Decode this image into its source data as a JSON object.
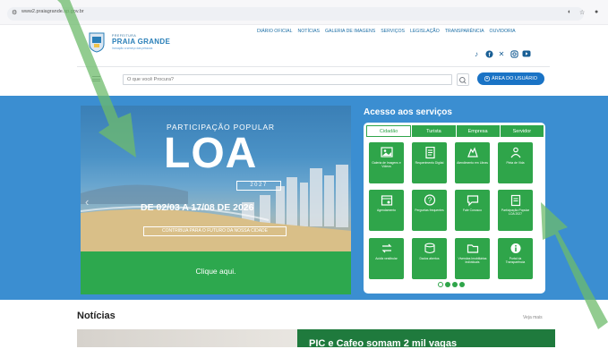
{
  "browser": {
    "url": "www2.praiagrande.sp.gov.br",
    "icons": [
      "site-info-icon",
      "hide-icon",
      "star-icon",
      "profile-icon"
    ]
  },
  "logo": {
    "small": "PREFEITURA",
    "title": "PRAIA GRANDE",
    "sub": "Inovação a serviço das pessoas"
  },
  "nav": [
    "DIÁRIO OFICIAL",
    "NOTÍCIAS",
    "GALERIA DE IMAGENS",
    "SERVIÇOS",
    "LEGISLAÇÃO",
    "TRANSPARÊNCIA",
    "OUVIDORIA"
  ],
  "socials": [
    "tiktok-icon",
    "facebook-icon",
    "x-icon",
    "instagram-icon",
    "youtube-icon"
  ],
  "search": {
    "placeholder": "O que você Procura?",
    "user_area": "ÁREA DO USUÁRIO"
  },
  "banner": {
    "header": "PARTICIPAÇÃO POPULAR",
    "title": "LOA",
    "year": "2027",
    "dates": "DE 02/03 A 17/08 DE 2026",
    "tagline": "CONTRIBUA PARA O FUTURO DA NOSSA CIDADE",
    "cta": "Clique aqui."
  },
  "services": {
    "title": "Acesso aos serviços",
    "tabs": [
      "Cidadão",
      "Turista",
      "Empresa",
      "Servidor"
    ],
    "active_tab": "Cidadão",
    "tiles": [
      {
        "label": "Galeria de Imagens e Vídeos",
        "icon": "image-icon"
      },
      {
        "label": "Requerimento Digital",
        "icon": "document-icon"
      },
      {
        "label": "Atendimento em Libras",
        "icon": "hands-icon"
      },
      {
        "label": "Pinta de Vida",
        "icon": "person-icon"
      },
      {
        "label": "Agendamento",
        "icon": "calendar-icon"
      },
      {
        "label": "Perguntas frequentes",
        "icon": "question-icon"
      },
      {
        "label": "Fale Conosco",
        "icon": "chat-icon"
      },
      {
        "label": "Participação Popular LOA 2027",
        "icon": "clipboard-icon"
      },
      {
        "label": "Acidiz vestibular",
        "icon": "exchange-icon"
      },
      {
        "label": "Dados abertos",
        "icon": "database-icon"
      },
      {
        "label": "Vivendas Imobiliárias Individuais",
        "icon": "folder-icon"
      },
      {
        "label": "Portal da Transparência",
        "icon": "info-icon"
      }
    ],
    "active_dot": 0,
    "dot_count": 4
  },
  "news": {
    "title": "Notícias",
    "more": "Veja mais",
    "headline": "PIC e Cafeo somam 2 mil vagas"
  },
  "colors": {
    "brand_blue": "#1a73c5",
    "hero_blue": "#3b8ed1",
    "green": "#2fa54a",
    "arrow_green": "#6dbb6b"
  }
}
